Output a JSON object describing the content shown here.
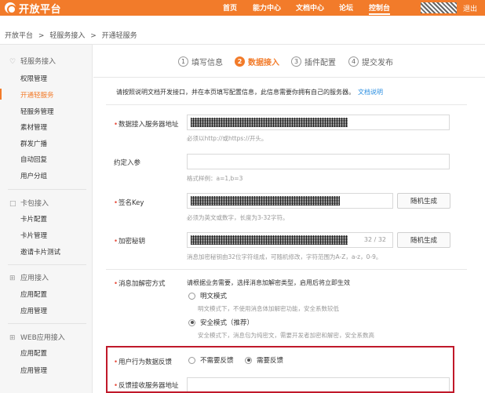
{
  "header": {
    "logo_text": "开放平台",
    "nav": [
      {
        "label": "首页"
      },
      {
        "label": "能力中心"
      },
      {
        "label": "文档中心"
      },
      {
        "label": "论坛"
      },
      {
        "label": "控制台"
      }
    ],
    "logout": "退出",
    "brand_color": "#f27b2a"
  },
  "breadcrumb": [
    "开放平台",
    ">",
    "轻服务接入",
    ">",
    "开通轻服务"
  ],
  "sidebar": {
    "groups": [
      {
        "title": "轻服务接入",
        "icon": "heart-icon",
        "items": [
          "权限管理",
          "开通轻服务",
          "轻服务管理",
          "素材管理",
          "群发广播",
          "自动回复",
          "用户分组"
        ]
      },
      {
        "title": "卡包接入",
        "icon": "square-icon",
        "items": [
          "卡片配置",
          "卡片管理",
          "邀请卡片测试"
        ]
      },
      {
        "title": "应用接入",
        "icon": "grid-icon",
        "items": [
          "应用配置",
          "应用管理"
        ]
      },
      {
        "title": "WEB应用接入",
        "icon": "grid-icon",
        "items": [
          "应用配置",
          "应用管理"
        ]
      }
    ],
    "active_item": "开通轻服务"
  },
  "steps": [
    {
      "num": "1",
      "label": "填写信息"
    },
    {
      "num": "2",
      "label": "数据接入"
    },
    {
      "num": "3",
      "label": "插件配置"
    },
    {
      "num": "4",
      "label": "提交发布"
    }
  ],
  "form": {
    "intro": "请按照说明文档开发接口，并在本页填写配置信息，此信息需要你拥有自己的服务器。",
    "intro_link": "文档说明",
    "server_url": {
      "label": "数据接入服务器地址",
      "hint": "必须以http://或https://开头。"
    },
    "params": {
      "label": "约定入参",
      "hint": "格式样例：a=1,b=3"
    },
    "sign_key": {
      "label": "签名Key",
      "hint": "必须为英文或数字，长度为3-32字符。",
      "button": "随机生成"
    },
    "secret": {
      "label": "加密秘钥",
      "counter": "32 / 32",
      "hint": "消息加密秘钥由32位字符组成，可随机修改，字符范围为A-Z，a-z，0-9。",
      "button": "随机生成"
    },
    "encrypt": {
      "label": "消息加解密方式",
      "desc": "请根据业务需要，选择消息加解密类型，启用后将立即生效",
      "options": [
        {
          "label": "明文模式",
          "desc": "明文模式下，不使用消息体加解密功能，安全系数较低"
        },
        {
          "label": "安全模式（推荐）",
          "desc": "安全模式下，消息包为纯密文，需要开发者加密和解密，安全系数高"
        }
      ]
    },
    "feedback": {
      "label": "用户行为数据反馈",
      "options": [
        {
          "label": "不需要反馈"
        },
        {
          "label": "需要反馈"
        }
      ]
    },
    "feedback_url": {
      "label": "反馈接收服务器地址"
    }
  }
}
